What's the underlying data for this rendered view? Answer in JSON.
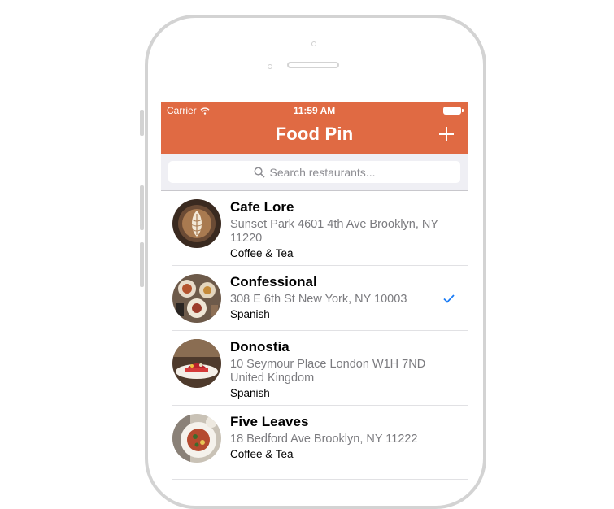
{
  "status_bar": {
    "carrier": "Carrier",
    "time": "11:59 AM"
  },
  "nav": {
    "title": "Food Pin",
    "add_icon": "plus-icon"
  },
  "search": {
    "placeholder": "Search restaurants..."
  },
  "restaurants": [
    {
      "name": "Cafe Lore",
      "location": "Sunset Park 4601 4th Ave Brooklyn, NY 11220",
      "type": "Coffee & Tea",
      "checked": false
    },
    {
      "name": "Confessional",
      "location": "308 E 6th St New York, NY 10003",
      "type": "Spanish",
      "checked": true
    },
    {
      "name": "Donostia",
      "location": "10 Seymour Place London W1H 7ND United Kingdom",
      "type": "Spanish",
      "checked": false
    },
    {
      "name": "Five Leaves",
      "location": "18 Bedford Ave Brooklyn, NY 11222",
      "type": "Coffee & Tea",
      "checked": false
    }
  ],
  "colors": {
    "nav_bar": "#e06a43",
    "checkmark": "#1a7cf6"
  }
}
